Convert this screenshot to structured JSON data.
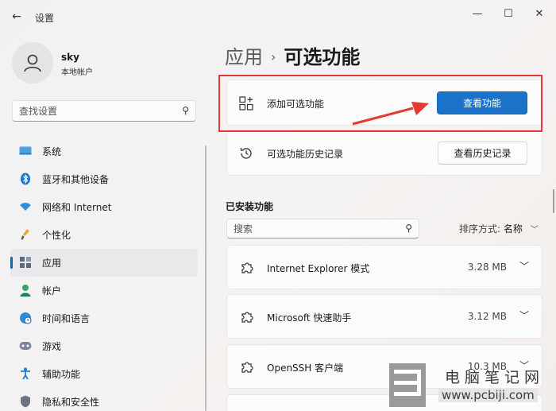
{
  "window": {
    "app_title": "设置",
    "controls": {
      "minimize": "—",
      "maximize": "☐",
      "close": "✕"
    }
  },
  "user": {
    "name": "sky",
    "type": "本地帐户"
  },
  "search": {
    "placeholder": "查找设置"
  },
  "nav": {
    "items": [
      {
        "label": "系统",
        "icon": "monitor-icon"
      },
      {
        "label": "蓝牙和其他设备",
        "icon": "bluetooth-icon"
      },
      {
        "label": "网络和 Internet",
        "icon": "wifi-icon"
      },
      {
        "label": "个性化",
        "icon": "brush-icon"
      },
      {
        "label": "应用",
        "icon": "apps-icon",
        "active": true
      },
      {
        "label": "帐户",
        "icon": "person-icon"
      },
      {
        "label": "时间和语言",
        "icon": "globe-clock-icon"
      },
      {
        "label": "游戏",
        "icon": "gamepad-icon"
      },
      {
        "label": "辅助功能",
        "icon": "accessibility-icon"
      },
      {
        "label": "隐私和安全性",
        "icon": "shield-icon"
      }
    ]
  },
  "breadcrumb": {
    "parent": "应用",
    "separator": "›",
    "current": "可选功能"
  },
  "add_feature": {
    "label": "添加可选功能",
    "button": "查看功能"
  },
  "history": {
    "label": "可选功能历史记录",
    "button": "查看历史记录"
  },
  "installed": {
    "title": "已安装功能",
    "search_placeholder": "搜索",
    "sort_label": "排序方式:",
    "sort_value": "名称",
    "features": [
      {
        "name": "Internet Explorer 模式",
        "size": "3.28 MB"
      },
      {
        "name": "Microsoft 快速助手",
        "size": "3.12 MB"
      },
      {
        "name": "OpenSSH 客户端",
        "size": "10.3 MB"
      }
    ]
  },
  "watermark": {
    "title": "电脑笔记网",
    "url": "www.pcbiji.com"
  },
  "colors": {
    "accent": "#1a73c9",
    "highlight": "#e53935",
    "nav_indicator": "#0067c0"
  }
}
